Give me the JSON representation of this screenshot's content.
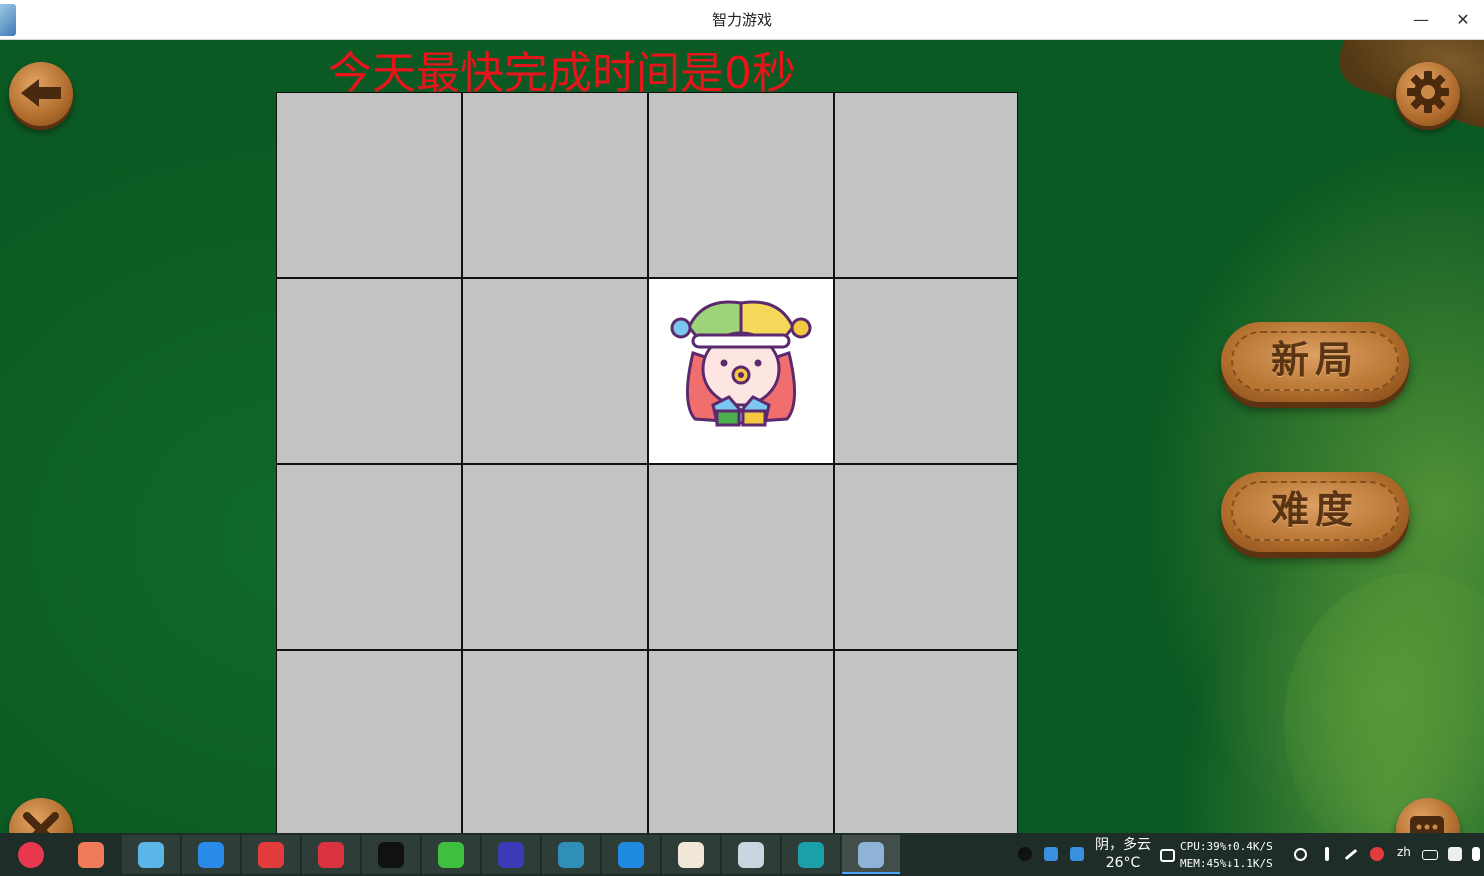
{
  "window": {
    "title": "智力游戏",
    "minimize_glyph": "—",
    "close_glyph": "✕"
  },
  "game": {
    "best_time_text": "今天最快完成时间是0秒",
    "grid": {
      "rows": 4,
      "cols": 4,
      "revealed_cell": {
        "row": 1,
        "col": 2,
        "image": "jester-girl-icon"
      }
    },
    "buttons": {
      "new_game": "新局",
      "difficulty": "难度"
    },
    "icons": {
      "back": "back-arrow-icon",
      "settings": "gear-icon",
      "close": "close-icon",
      "chat": "chat-icon"
    },
    "colors": {
      "table_green": "#0d5e25",
      "cell_gray": "#c3c3c3",
      "text_red": "#e6141b",
      "wood": "#b06c2c"
    }
  },
  "taskbar": {
    "apps": [
      {
        "name": "launcher",
        "color": "#e8384f"
      },
      {
        "name": "screen-recorder",
        "color": "#f07b5b"
      },
      {
        "name": "file-manager",
        "color": "#5bb6e8"
      },
      {
        "name": "app-store",
        "color": "#2a8ae8"
      },
      {
        "name": "netease-music",
        "color": "#e33b3b"
      },
      {
        "name": "terminal",
        "color": "#d9333f"
      },
      {
        "name": "qq",
        "color": "#111111"
      },
      {
        "name": "wechat",
        "color": "#3fbf3f"
      },
      {
        "name": "system-monitor",
        "color": "#3b3bb8"
      },
      {
        "name": "activity-monitor",
        "color": "#2f8fb8"
      },
      {
        "name": "vscode",
        "color": "#1f8be0"
      },
      {
        "name": "image-viewer",
        "color": "#f0e7d8"
      },
      {
        "name": "package-installer",
        "color": "#c9d6e0"
      },
      {
        "name": "edge-browser",
        "color": "#1aa0a8"
      },
      {
        "name": "puzzle-game",
        "color": "#8fb3d8"
      }
    ],
    "weather": {
      "line1": "阴，多云",
      "line2": "26°C"
    },
    "sysmon": {
      "line1": "CPU:39%↑0.4K/S",
      "line2": "MEM:45%↓1.1K/S"
    },
    "language": "zh"
  }
}
